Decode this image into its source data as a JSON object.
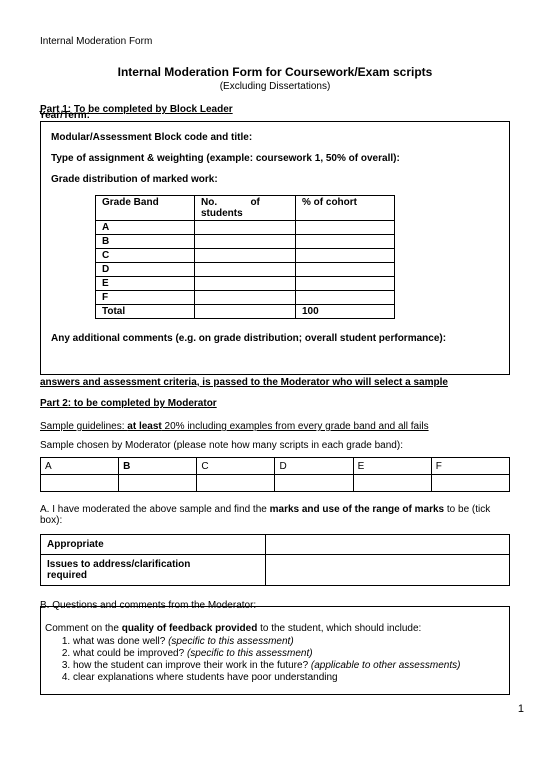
{
  "header": "Internal Moderation Form",
  "title": "Internal Moderation Form for Coursework/Exam scripts",
  "subtitle": "(Excluding Dissertations)",
  "part1": "Part 1: To be completed by Block Leader",
  "box1": {
    "yearterm": "Year/Term:",
    "r1": "Modular/Assessment Block code and title:",
    "r2": "Type of assignment & weighting (example: coursework 1, 50% of overall):",
    "r3": "Grade distribution of marked work:",
    "th_gb": "Grade Band",
    "th_ns_a": "No.",
    "th_ns_b": "of",
    "th_ns_c": "students",
    "th_pc": "% of cohort",
    "bands": [
      "A",
      "B",
      "C",
      "D",
      "E",
      "F"
    ],
    "total": "Total",
    "total_pc": "100",
    "addl": "Any additional comments (e.g. on grade distribution; overall student performance):"
  },
  "bridge": "answers and assessment criteria, is passed to the Moderator who will select a sample",
  "part2": "Part 2: to be completed by Moderator",
  "sample": {
    "guide_a": "Sample guidelines: ",
    "guide_b": "at least",
    "guide_c": " 20% including examples from every grade band and all fails",
    "chosen": "Sample chosen by Moderator (please note how many scripts in each grade band):",
    "cols": [
      "A",
      "B",
      "C",
      "D",
      "E",
      "F"
    ]
  },
  "sectA": {
    "pre": "A.  I have moderated the above sample and find the ",
    "bold": "marks and use of the range of marks",
    "post": " to be (tick box):"
  },
  "appro": {
    "r1": "Appropriate",
    "r2a": "Issues to address/clarification",
    "r2b": "required"
  },
  "sectB": "B.  Questions and comments from the Moderator:",
  "comment": {
    "lead_a": "Comment on the ",
    "lead_b": "quality of feedback provided",
    "lead_c": " to the student, which should include:",
    "i1a": "what was done well? ",
    "i1b": "(specific to this assessment)",
    "i2a": "what could be improved? ",
    "i2b": "(specific to this assessment)",
    "i3a": "how the student can improve their work in the future? ",
    "i3b": "(applicable to other assessments)",
    "i4": "clear explanations where students have poor understanding"
  },
  "pgnum": "1"
}
